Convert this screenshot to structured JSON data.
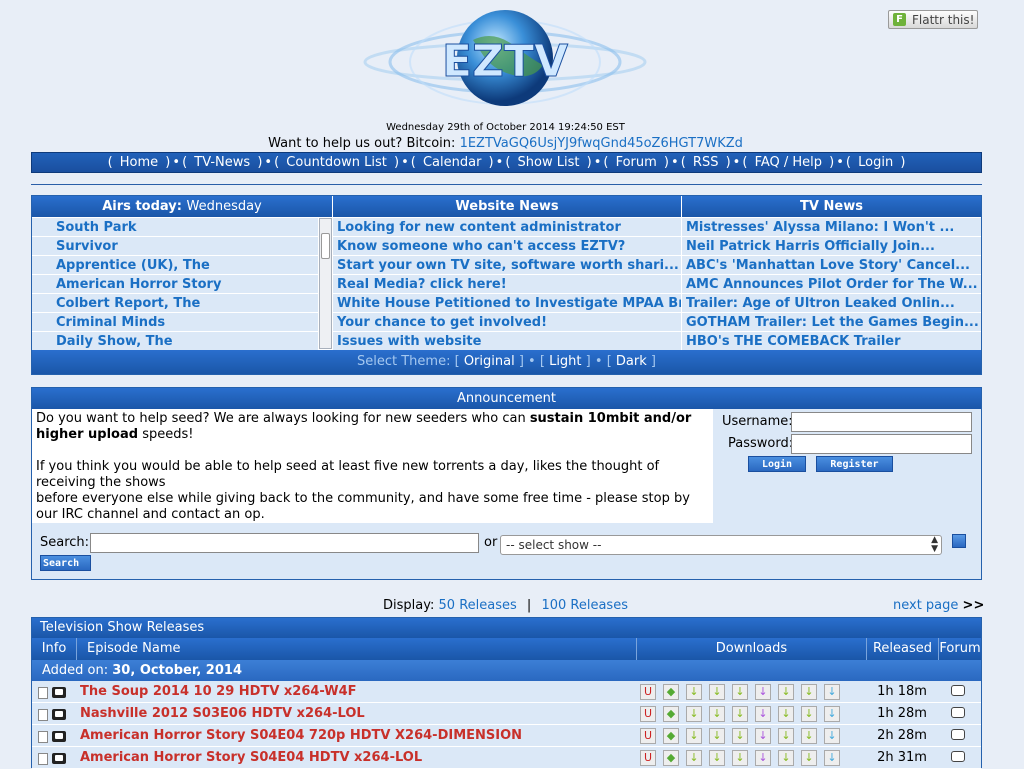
{
  "header": {
    "logo_text": "EZTV",
    "flattr_label": "Flattr this!",
    "datetime": "Wednesday 29th of October 2014 19:24:50 EST",
    "bitcoin_prefix": "Want to help us out? Bitcoin:",
    "bitcoin_address": "1EZTVaGQ6UsjYJ9fwqGnd45oZ6HGT7WKZd"
  },
  "nav": [
    "Home",
    "TV-News",
    "Countdown List",
    "Calendar",
    "Show List",
    "Forum",
    "RSS",
    "FAQ / Help",
    "Login"
  ],
  "airs_today": {
    "label": "Airs today:",
    "day": "Wednesday",
    "shows": [
      "South Park",
      "Survivor",
      "Apprentice (UK), The",
      "American Horror Story",
      "Colbert Report, The",
      "Criminal Minds",
      "Daily Show, The"
    ]
  },
  "website_news": {
    "title": "Website News",
    "items": [
      "Looking for new content administrator",
      "Know someone who can't access EZTV?",
      "Start your own TV site, software worth shari...",
      "Real Media? click here!",
      "White House Petitioned to Investigate MPAA Br...",
      "Your chance to get involved!",
      "Issues with website"
    ]
  },
  "tv_news": {
    "title": "TV News",
    "items": [
      "Mistresses' Alyssa Milano: I Won't ...",
      "Neil Patrick Harris Officially Join...",
      "ABC's 'Manhattan Love Story' Cancel...",
      "AMC Announces Pilot Order for The W...",
      "Trailer: Age of Ultron Leaked Onlin...",
      "GOTHAM Trailer: Let the Games Begin...",
      "HBO's THE COMEBACK Trailer"
    ]
  },
  "theme": {
    "label": "Select Theme:",
    "options": [
      "Original",
      "Light",
      "Dark"
    ]
  },
  "announcement": {
    "title": "Announcement",
    "p1_a": "Do you want to help seed? We are always looking for new seeders who can ",
    "p1_bold": "sustain 10mbit and/or higher upload",
    "p1_b": " speeds!",
    "p2_a": "If you think you would be able to help seed at least five new torrents a day, likes the thought of receiving the shows",
    "p2_b": "before everyone else while giving back to the community, and have some free time - please stop by our IRC channel and contact an op."
  },
  "login": {
    "username_label": "Username:",
    "password_label": "Password:",
    "login_btn": "Login",
    "register_btn": "Register"
  },
  "search": {
    "label": "Search:",
    "or": "or",
    "select_placeholder": "-- select show --",
    "button": "Search"
  },
  "display": {
    "label": "Display:",
    "opt1": "50 Releases",
    "sep": "|",
    "opt2": "100 Releases",
    "next": "next page",
    "next_arrows": ">>"
  },
  "releases": {
    "title": "Television Show Releases",
    "columns": [
      "Info",
      "Episode Name",
      "Downloads",
      "Released",
      "Forum"
    ],
    "added_label": "Added on:",
    "added_date": "30, October, 2014",
    "rows": [
      {
        "name": "The Soup 2014 10 29 HDTV x264-W4F",
        "released": "1h 18m"
      },
      {
        "name": "Nashville 2012 S03E06 HDTV x264-LOL",
        "released": "1h 28m"
      },
      {
        "name": "American Horror Story S04E04 720p HDTV X264-DIMENSION",
        "released": "2h 28m"
      },
      {
        "name": "American Horror Story S04E04 HDTV x264-LOL",
        "released": "2h 31m"
      }
    ]
  }
}
